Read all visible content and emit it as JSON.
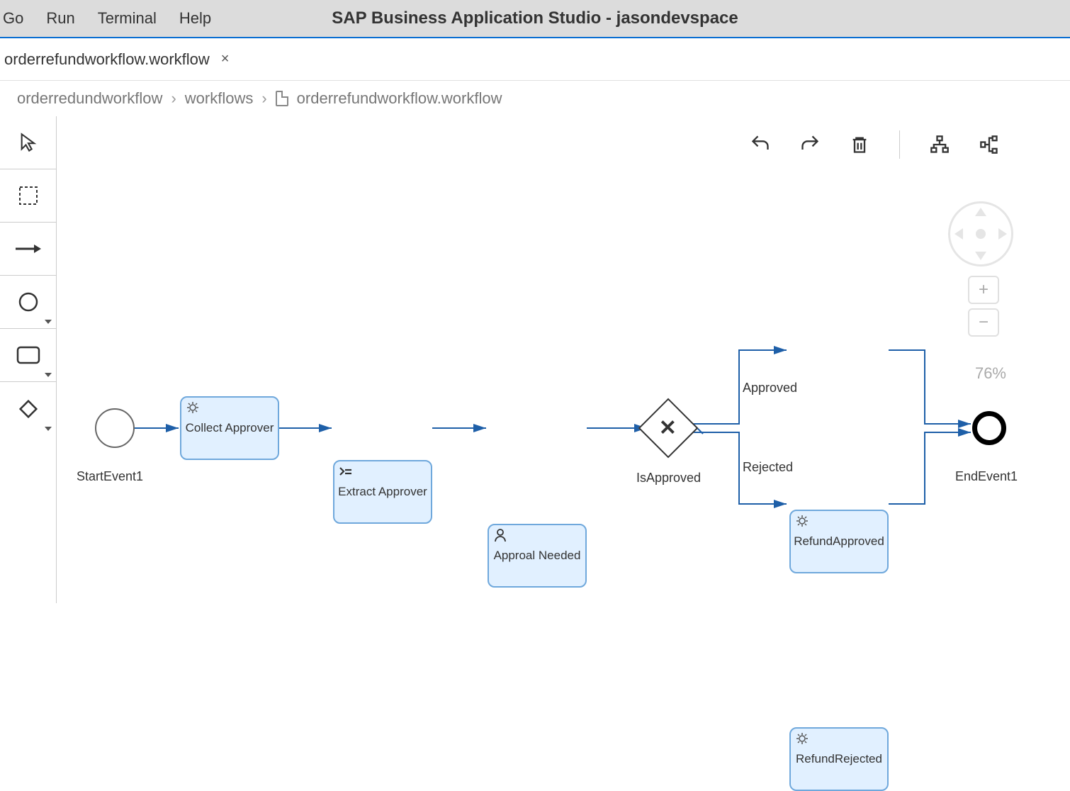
{
  "menubar": {
    "items": [
      "Go",
      "Run",
      "Terminal",
      "Help"
    ],
    "title": "SAP Business Application Studio - jasondevspace"
  },
  "tab": {
    "name": "orderrefundworkflow.workflow",
    "close": "×"
  },
  "breadcrumb": {
    "segments": [
      "orderredundworkflow",
      "workflows",
      "orderrefundworkflow.workflow"
    ],
    "chev": "›"
  },
  "zoom": {
    "level": "76%",
    "plus": "+",
    "minus": "−"
  },
  "palette": {
    "cursor": "cursor",
    "marquee": "marquee",
    "connector": "connector",
    "start_event": "start-event",
    "task": "task",
    "gateway": "gateway"
  },
  "toolbar": {
    "undo": "undo",
    "redo": "redo",
    "delete": "delete",
    "layout1": "layout-tree",
    "layout2": "layout-org"
  },
  "nodes": {
    "start": {
      "label": "StartEvent1"
    },
    "collect": {
      "label": "Collect Approver"
    },
    "extract": {
      "label": "Extract Approver"
    },
    "approval": {
      "label": "Approal Needed"
    },
    "gateway": {
      "label": "IsApproved"
    },
    "approved": {
      "label": "RefundApproved"
    },
    "rejected": {
      "label": "RefundRejected"
    },
    "end": {
      "label": "EndEvent1"
    }
  },
  "edges": {
    "approved": "Approved",
    "rejected": "Rejected"
  }
}
